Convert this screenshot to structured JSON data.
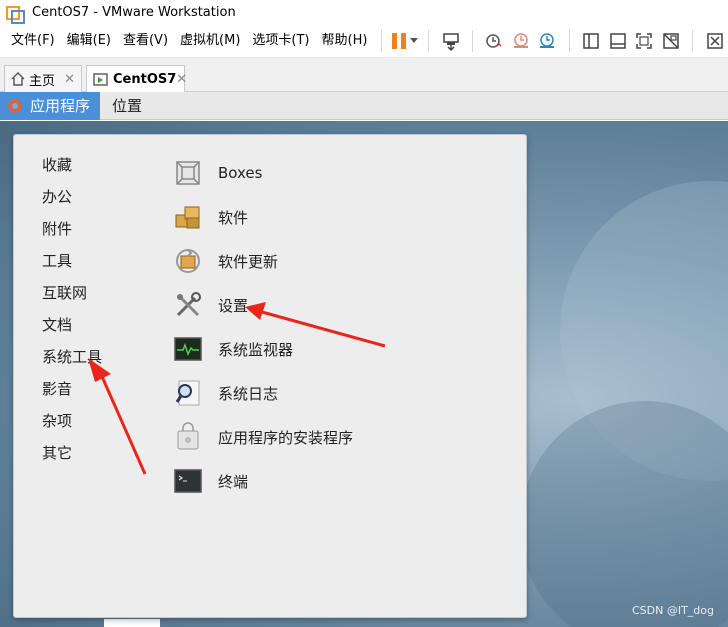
{
  "window": {
    "title": "CentOS7 - VMware Workstation"
  },
  "menu": {
    "items": [
      "文件(F)",
      "编辑(E)",
      "查看(V)",
      "虚拟机(M)",
      "选项卡(T)",
      "帮助(H)"
    ]
  },
  "toolbar": {
    "icons": [
      "pause-icon",
      "send-keys-icon",
      "snapshot-icon",
      "revert-snapshot-icon",
      "snapshot-manager-icon",
      "sidebar-icon",
      "console-view-icon",
      "fullscreen-icon",
      "unity-icon",
      "thumbnail-icon"
    ],
    "pause_color": "#f07f1f"
  },
  "tabs": [
    {
      "label": "主页",
      "icon": "home-icon"
    },
    {
      "label": "CentOS7",
      "icon": "vm-running-icon"
    }
  ],
  "guest_panel": {
    "applications": "应用程序",
    "places": "位置",
    "accent": "#4a90d9"
  },
  "categories": [
    "收藏",
    "办公",
    "附件",
    "工具",
    "互联网",
    "文档",
    "系统工具",
    "影音",
    "杂项",
    "其它"
  ],
  "apps": [
    {
      "label": "Boxes",
      "icon": "boxes-icon"
    },
    {
      "label": "软件",
      "icon": "software-icon"
    },
    {
      "label": "软件更新",
      "icon": "software-update-icon"
    },
    {
      "label": "设置",
      "icon": "settings-icon"
    },
    {
      "label": "系统监视器",
      "icon": "system-monitor-icon"
    },
    {
      "label": "系统日志",
      "icon": "system-log-icon"
    },
    {
      "label": "应用程序的安装程序",
      "icon": "app-installer-icon"
    },
    {
      "label": "终端",
      "icon": "terminal-icon"
    }
  ],
  "watermark": "CSDN @IT_dog",
  "annotation_color": "#e8261c"
}
